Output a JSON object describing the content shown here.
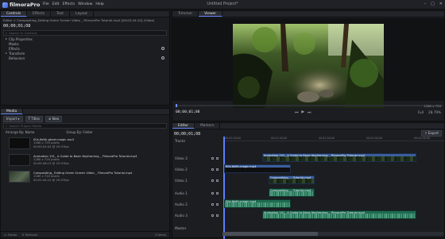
{
  "app": {
    "name": "filmoraPro",
    "project_title": "Untitled Project*"
  },
  "menu": [
    "File",
    "Edit",
    "Effects",
    "Window",
    "Help"
  ],
  "left_panel": {
    "tabs": [
      "Controls",
      "Effects",
      "Text",
      "Layout"
    ],
    "breadcrumb": "Editor > Compositing_Editing Green Screen Video _ FilmoraPro Tutorial.mp4 [00:02:44:10] (Video)",
    "timecode": "00;00;01;08",
    "search_placeholder": "Search In Controls",
    "properties": [
      "Clip Properties",
      "Masks",
      "Effects",
      "Transform",
      "Behaviors"
    ]
  },
  "media_panel": {
    "title": "Media",
    "buttons": [
      "Import",
      "Titles",
      "New"
    ],
    "search_placeholder": "Search Project Media",
    "arrange_label": "Arrange By: Name",
    "group_label": "Group By: Folder",
    "items": [
      {
        "name": "00s-Keith-ghost-magic.mp4",
        "meta1": "1280 x 720 pixels",
        "meta2": "00:00:04:04 @ 29.97fps",
        "thumb": "#0d0d0d"
      },
      {
        "name": "Animation 101_ A Guide to Basic Keyframing _ FilmoraPro Tutorial.mp4",
        "meta1": "1280 x 720 pixels",
        "meta2": "00:05:08:13 @ 29.97fps",
        "thumb": "#111214"
      },
      {
        "name": "Compositing_ Editing Green Screen Video _ FilmoraPro Tutorial.mp4",
        "meta1": "1280 x 720 pixels",
        "meta2": "00:02:44:10 @ 29.97fps",
        "thumb": "#3c4a3a"
      }
    ],
    "bottom": [
      "Folder",
      "Remove",
      "3 Items"
    ]
  },
  "viewer": {
    "tabs": [
      "Trimmer",
      "Viewer"
    ],
    "timecode": "00;00;01;08",
    "zoom": "Full",
    "zoom_level": "28.79%",
    "res_label": "1280 x 720"
  },
  "timeline": {
    "tabs": [
      "Editor",
      "Markers"
    ],
    "timecode": "00;00;01;08",
    "export_label": "Export",
    "ruler_labels": [
      "00;00;00;00",
      "00;01;00;00",
      "00;02;00;00",
      "00;03;00;00",
      "00;04;00;00"
    ],
    "tracks": [
      "Tracks",
      "Video 3",
      "Video 2",
      "Video 1",
      "Audio 1",
      "Audio 2",
      "Audio 3",
      "Master"
    ],
    "clips": {
      "v3": "Animation 101_ A Guide to Basic Keyframing _ FilmoraPro Tutorial.mp4 ",
      "v2": "00s-Keith-magic.mp4",
      "v1": "Compositing_... Tutorial.mp4",
      "a1": "Compositing_... Tutorial.mp4",
      "a2": "00s-Keith-magic.mp4",
      "a3": "Animation 101_ A Guide to Basic Keyframing _ FilmoraPro Tutorial.mp4 "
    }
  }
}
